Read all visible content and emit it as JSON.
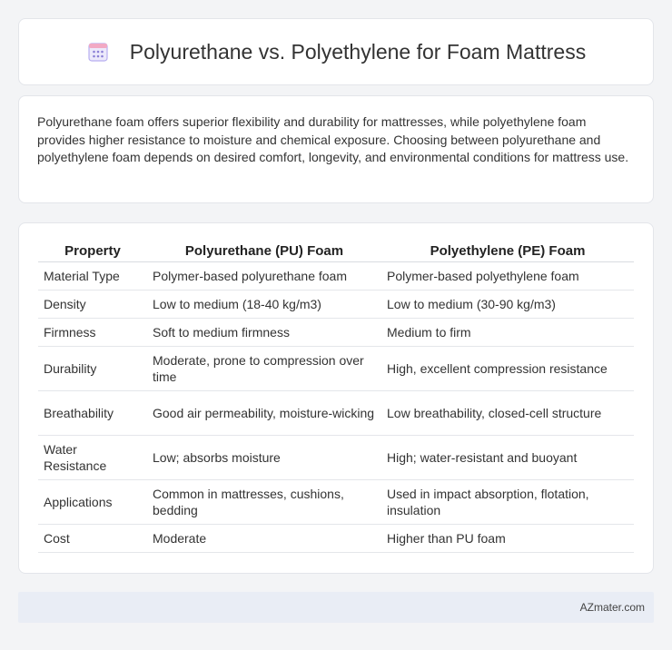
{
  "header": {
    "icon": "calendar-icon",
    "title": "Polyurethane vs. Polyethylene for Foam Mattress"
  },
  "intro": {
    "text": "Polyurethane foam offers superior flexibility and durability for mattresses, while polyethylene foam provides higher resistance to moisture and chemical exposure. Choosing between polyurethane and polyethylene foam depends on desired comfort, longevity, and environmental conditions for mattress use."
  },
  "table": {
    "headers": [
      "Property",
      "Polyurethane (PU) Foam",
      "Polyethylene (PE) Foam"
    ],
    "rows": [
      [
        "Material Type",
        "Polymer-based polyurethane foam",
        "Polymer-based polyethylene foam"
      ],
      [
        "Density",
        "Low to medium (18-40 kg/m3)",
        "Low to medium (30-90 kg/m3)"
      ],
      [
        "Firmness",
        "Soft to medium firmness",
        "Medium to firm"
      ],
      [
        "Durability",
        "Moderate, prone to compression over time",
        "High, excellent compression resistance"
      ],
      [
        "Breathability",
        "Good air permeability, moisture-wicking",
        "Low breathability, closed-cell structure"
      ],
      [
        "Water Resistance",
        "Low; absorbs moisture",
        "High; water-resistant and buoyant"
      ],
      [
        "Applications",
        "Common in mattresses, cushions, bedding",
        "Used in impact absorption, flotation, insulation"
      ],
      [
        "Cost",
        "Moderate",
        "Higher than PU foam"
      ]
    ]
  },
  "footer": {
    "text": "AZmater.com"
  },
  "colors": {
    "background": "#f3f4f6",
    "card": "#ffffff",
    "footer_bg": "#e9edf5",
    "icon_accent": "#8b7fd6"
  }
}
